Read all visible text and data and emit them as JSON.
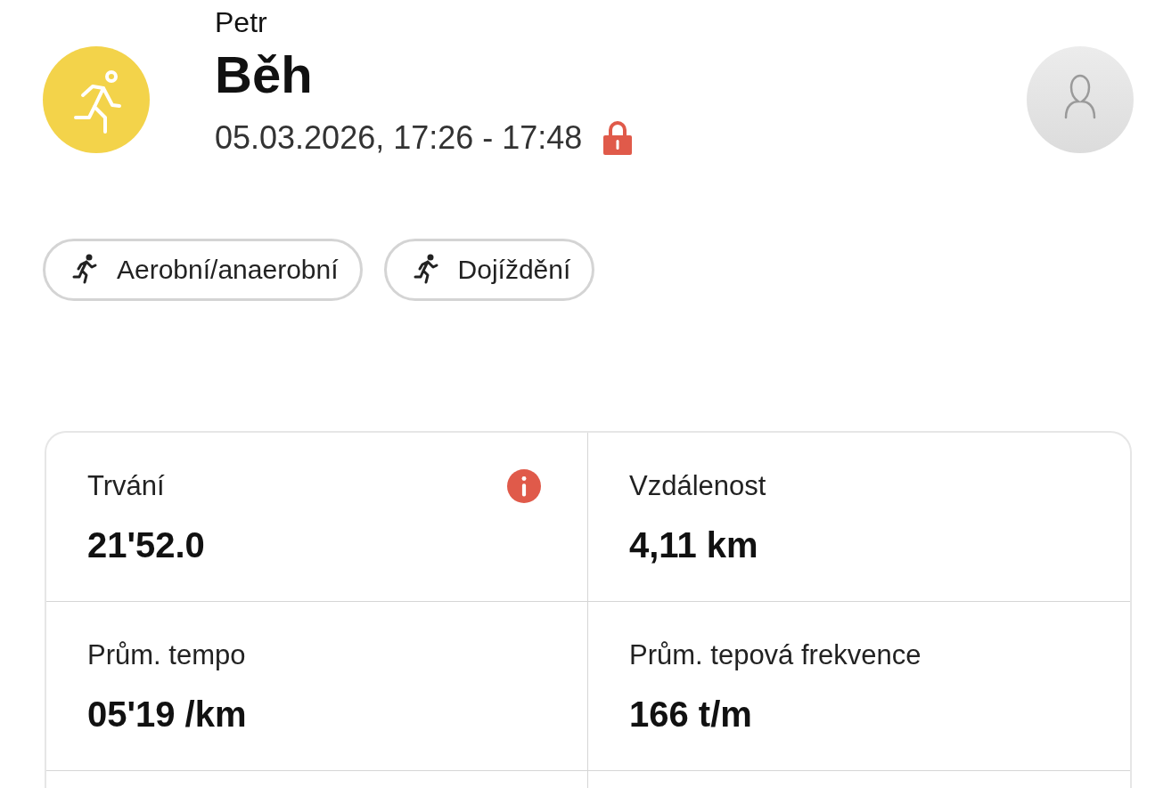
{
  "header": {
    "user": "Petr",
    "activity": "Běh",
    "datetime": "05.03.2026, 17:26 - 17:48",
    "locked": true
  },
  "tags": [
    {
      "label": "Aerobní/anaerobní"
    },
    {
      "label": "Dojíždění"
    }
  ],
  "stats": [
    {
      "label": "Trvání",
      "value": "21'52.0",
      "info": true
    },
    {
      "label": "Vzdálenost",
      "value": "4,11 km",
      "info": false
    },
    {
      "label": "Prům. tempo",
      "value": "05'19 /km",
      "info": false
    },
    {
      "label": "Prům. tepová frekvence",
      "value": "166 t/m",
      "info": false
    }
  ]
}
